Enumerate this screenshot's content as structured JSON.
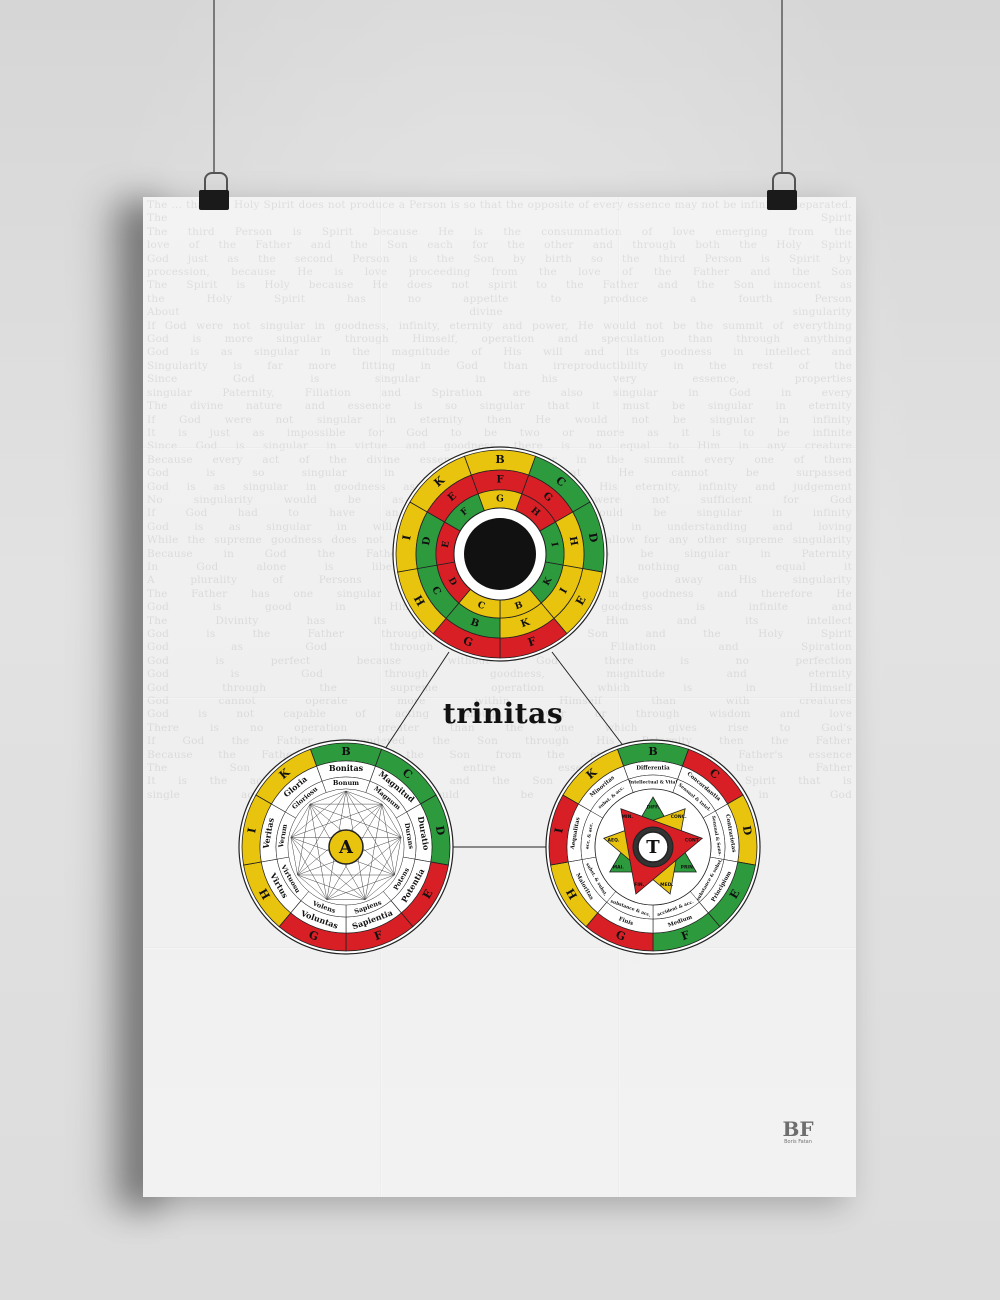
{
  "poster": {
    "title": "trinitas",
    "logo_mark": "BF",
    "logo_sub": "Boris Fatan",
    "background_text": [
      "The ... that the Holy Spirit does not produce a Person is so that the opposite of every essence may not be infinitely separated. The Spirit",
      "The third Person is Spirit because He is the consummation of love emerging from the",
      "love of the Father and the Son each for the other and through both the Holy Spirit",
      "God just as the second Person is the Son by birth so the third Person is Spirit by",
      "procession, because He is love proceeding from the love of the Father and the Son",
      "The Spirit is Holy because He does not spirit to the Father and the Son innocent as",
      "the Holy Spirit has no appetite to produce a fourth Person",
      "About divine singularity",
      "If God were not singular in goodness, infinity, eternity and power, He would not be the summit of everything",
      "God is more singular through Himself, operation and speculation than through anything",
      "God is as singular in the magnitude of His will and its goodness in intellect and",
      "Singularity is far more fitting in God than irreproductibility in the rest of the",
      "Since God is singular in his very essence, properties",
      "singular Paternity, Filiation and Spiration are also singular in God in every",
      "The divine nature and essence is so singular that it must be singular in eternity",
      "If God were not singular in eternity then He would not be singular in infinity",
      "It is just as impossible for God to be two or more as it is to be infinite",
      "Since God is singular in virtue and goodness there is no equal to Him in any creature",
      "Because every act of the divine essence is singular in the summit every one of them",
      "God is so singular in His power that He cannot be surpassed",
      "God is as singular in goodness as in magnitude through His eternity, infinity and judgement",
      "No singularity would be as great if there were not sufficient for God",
      "If God had to have an equal then He would be singular in infinity",
      "God is as singular in will, power and wisdom as in understanding and loving",
      "While the supreme goodness does not allow for any equal, it does not allow for any other supreme singularity",
      "Because in God the Father allows the Son to be singular in Paternity",
      "In God alone is liberality so great that nothing can equal it",
      "A plurality of Persons in God does not take away His singularity",
      "The Father has one singular Son, equal to Himself in goodness and therefore He",
      "God is good in Himself and His goodness is infinite and",
      "The Divinity has its being through Him and its intellect",
      "God is the Father through whom the Son and the Holy Spirit",
      "God as God through Paternity, Filiation and Spiration",
      "God is perfect because without God there is no perfection",
      "God is God through goodness, magnitude and eternity",
      "God through the supreme operation which is in Himself",
      "God cannot operate more within Himself than with creatures",
      "God is not capable of acting through power or through wisdom and love",
      "There is no operation greater than the one which gives rise to God's",
      "If God the Father engendered the Son through His Paternity then the Father",
      "Because the Father engenders the Son from the entirety of the Father's essence",
      "The Son is the entire essence of the Father",
      "It is the action that the Father and the Son have in the Holy Spirit that is",
      "single action there would be no more in God"
    ]
  },
  "top_wheel": {
    "outer_letters": [
      "B",
      "C",
      "D",
      "E",
      "F",
      "G",
      "H",
      "I",
      "K"
    ],
    "middle_letters": [
      "F",
      "G",
      "H",
      "I",
      "K",
      "B",
      "C",
      "D",
      "E"
    ],
    "inner_letters": [
      "G",
      "H",
      "I",
      "K",
      "B",
      "C",
      "D",
      "E",
      "F"
    ],
    "outer_colors": [
      "#e8c40f",
      "#2e9a3e",
      "#2e9a3e",
      "#e8c40f",
      "#d81f26",
      "#d81f26",
      "#e8c40f",
      "#e8c40f",
      "#e8c40f"
    ],
    "middle_colors": [
      "#d81f26",
      "#d81f26",
      "#e8c40f",
      "#e8c40f",
      "#e8c40f",
      "#2e9a3e",
      "#2e9a3e",
      "#2e9a3e",
      "#d81f26"
    ],
    "inner_colors": [
      "#e8c40f",
      "#d81f26",
      "#2e9a3e",
      "#2e9a3e",
      "#e8c40f",
      "#e8c40f",
      "#d81f26",
      "#d81f26",
      "#2e9a3e"
    ]
  },
  "left_wheel": {
    "center_letter": "A",
    "outer_letters": [
      "B",
      "C",
      "D",
      "E",
      "F",
      "G",
      "H",
      "I",
      "K"
    ],
    "outer_colors": [
      "#2e9a3e",
      "#2e9a3e",
      "#2e9a3e",
      "#d81f26",
      "#d81f26",
      "#d81f26",
      "#e8c40f",
      "#e8c40f",
      "#e8c40f"
    ],
    "principles": [
      "Bonitas",
      "Magnitud",
      "Duratio",
      "Potentia",
      "Sapientia",
      "Voluntas",
      "Virtus",
      "Veritas",
      "Gloria"
    ],
    "adjectives": [
      "Bonum",
      "Magnum",
      "Durans",
      "Potens",
      "Sapiens",
      "Volens",
      "Virtuosu",
      "Verum",
      "Gloriosu"
    ]
  },
  "right_wheel": {
    "center_letter": "T",
    "outer_letters": [
      "B",
      "C",
      "D",
      "E",
      "F",
      "G",
      "H",
      "I",
      "K"
    ],
    "outer_colors": [
      "#2e9a3e",
      "#d81f26",
      "#e8c40f",
      "#2e9a3e",
      "#2e9a3e",
      "#d81f26",
      "#e8c40f",
      "#d81f26",
      "#e8c40f"
    ],
    "relatives": [
      "Differentia",
      "Concordantia",
      "Contrarietas",
      "Principium",
      "Medium",
      "Finis",
      "Maioritas",
      "Aequalitas",
      "Minoritas"
    ],
    "sub_entries": [
      "Intellectual & Vital",
      "Sensual & Intel.",
      "Sensual & Sens.",
      "substance & subst.",
      "accident & acc.",
      "substance & acc.",
      "subst. & subst.",
      "acc. & acc.",
      "subst. & acc."
    ],
    "triangle_labels": [
      "DIFF.",
      "CONC.",
      "CONT.",
      "PRIN.",
      "MED.",
      "FIN.",
      "MAI.",
      "AEQ.",
      "MIN."
    ]
  }
}
